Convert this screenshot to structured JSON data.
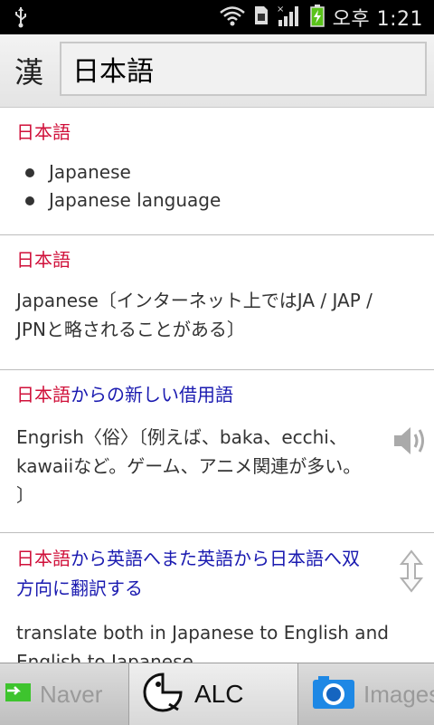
{
  "status_bar": {
    "time": "오후 1:21",
    "icons": [
      "usb-icon",
      "wifi-icon",
      "sim-icon",
      "signal-icon",
      "battery-charging-icon"
    ]
  },
  "search": {
    "mode_button": "漢",
    "query": "日本語"
  },
  "entries": [
    {
      "headword": "日本語",
      "meanings": [
        "Japanese",
        "Japanese language"
      ]
    },
    {
      "headword": "日本語",
      "text_line1": "Japanese〔インターネット上ではJA / JAP /",
      "text_line2": "JPNと略されることがある〕"
    },
    {
      "headword": "日本語",
      "headword_rest": "からの新しい借用語",
      "text_line1": "Engrish〈俗〉〔例えば、baka、ecchi、",
      "text_line2": "kawaiiなど。ゲーム、アニメ関連が多い。",
      "text_line3": "〕"
    },
    {
      "headword": "日本語",
      "title_rest_line1": "から英語へまた英語から日本語へ双",
      "title_line2": "方向に翻訳する",
      "text_line1": "translate both in Japanese to English and",
      "text_line2": "English to Japanese"
    }
  ],
  "tabs": {
    "naver": "Naver",
    "alc": "ALC",
    "images": "Images"
  },
  "colors": {
    "headword": "#d0103a",
    "phrase": "#1a1ab0",
    "status_bar": "#000000"
  }
}
